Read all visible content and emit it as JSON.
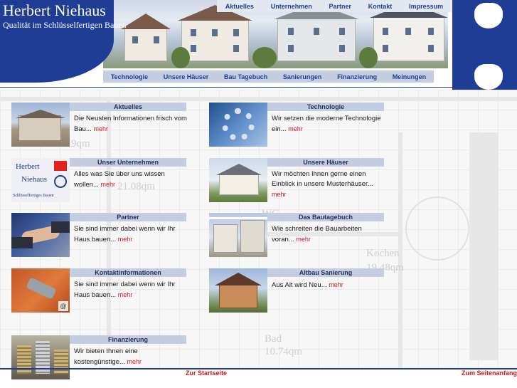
{
  "brand": {
    "title": "Herbert Niehaus",
    "subtitle": "Qualität im Schlüsselfertigen Bauen"
  },
  "top_nav": [
    "Aktuelles",
    "Unternehmen",
    "Partner",
    "Kontakt",
    "Impressum"
  ],
  "sub_nav": [
    "Technologie",
    "Unsere Häuser",
    "Bau Tagebuch",
    "Sanierungen",
    "Finanzierung",
    "Meinungen"
  ],
  "blueprint_labels": [
    "9qm",
    "21.08qm",
    "Kochen",
    "19.48qm",
    "Bad",
    "10.74qm",
    "WC"
  ],
  "logo_tile": {
    "line1": "Herbert",
    "line2": "Niehaus",
    "caption": "Schlüsselfertiges Bauen"
  },
  "teasers": [
    {
      "title": "Aktuelles",
      "text": "Die Neusten Informationen frisch vom Bau...",
      "more": "mehr"
    },
    {
      "title": "Technologie",
      "text": "Wir setzen die moderne Technologie ein...",
      "more": "mehr"
    },
    {
      "title": "Unser Unternehmen",
      "text": "Alles was Sie über uns wissen wollen...",
      "more": "mehr"
    },
    {
      "title": "Unsere Häuser",
      "text": "Wir möchten Ihnen gerne einen Einblick in unsere Musterhäuser...",
      "more": "mehr"
    },
    {
      "title": "Partner",
      "text": "Sie sind immer dabei wenn wir Ihr Haus bauen...",
      "more": "mehr"
    },
    {
      "title": "Das Bautagebuch",
      "text": "Wie schreiten die Bauarbeiten voran...",
      "more": "mehr"
    },
    {
      "title": "Kontaktinformationen",
      "text": "Sie sind immer dabei wenn wir Ihr Haus bauen...",
      "more": "mehr"
    },
    {
      "title": "Altbau Sanierung",
      "text": "Aus Alt wird Neu...",
      "more": "mehr"
    },
    {
      "title": "Finanzierung",
      "text": "Wir bieten Ihnen eine kostengünstige...",
      "more": "mehr"
    }
  ],
  "footer": {
    "left": "Zur Startseite",
    "right": "Zum Seitenanfang"
  },
  "colors": {
    "brand_blue": "#1f3d95",
    "title_bar": "#c5cde0",
    "link_red": "#d01a1a"
  }
}
